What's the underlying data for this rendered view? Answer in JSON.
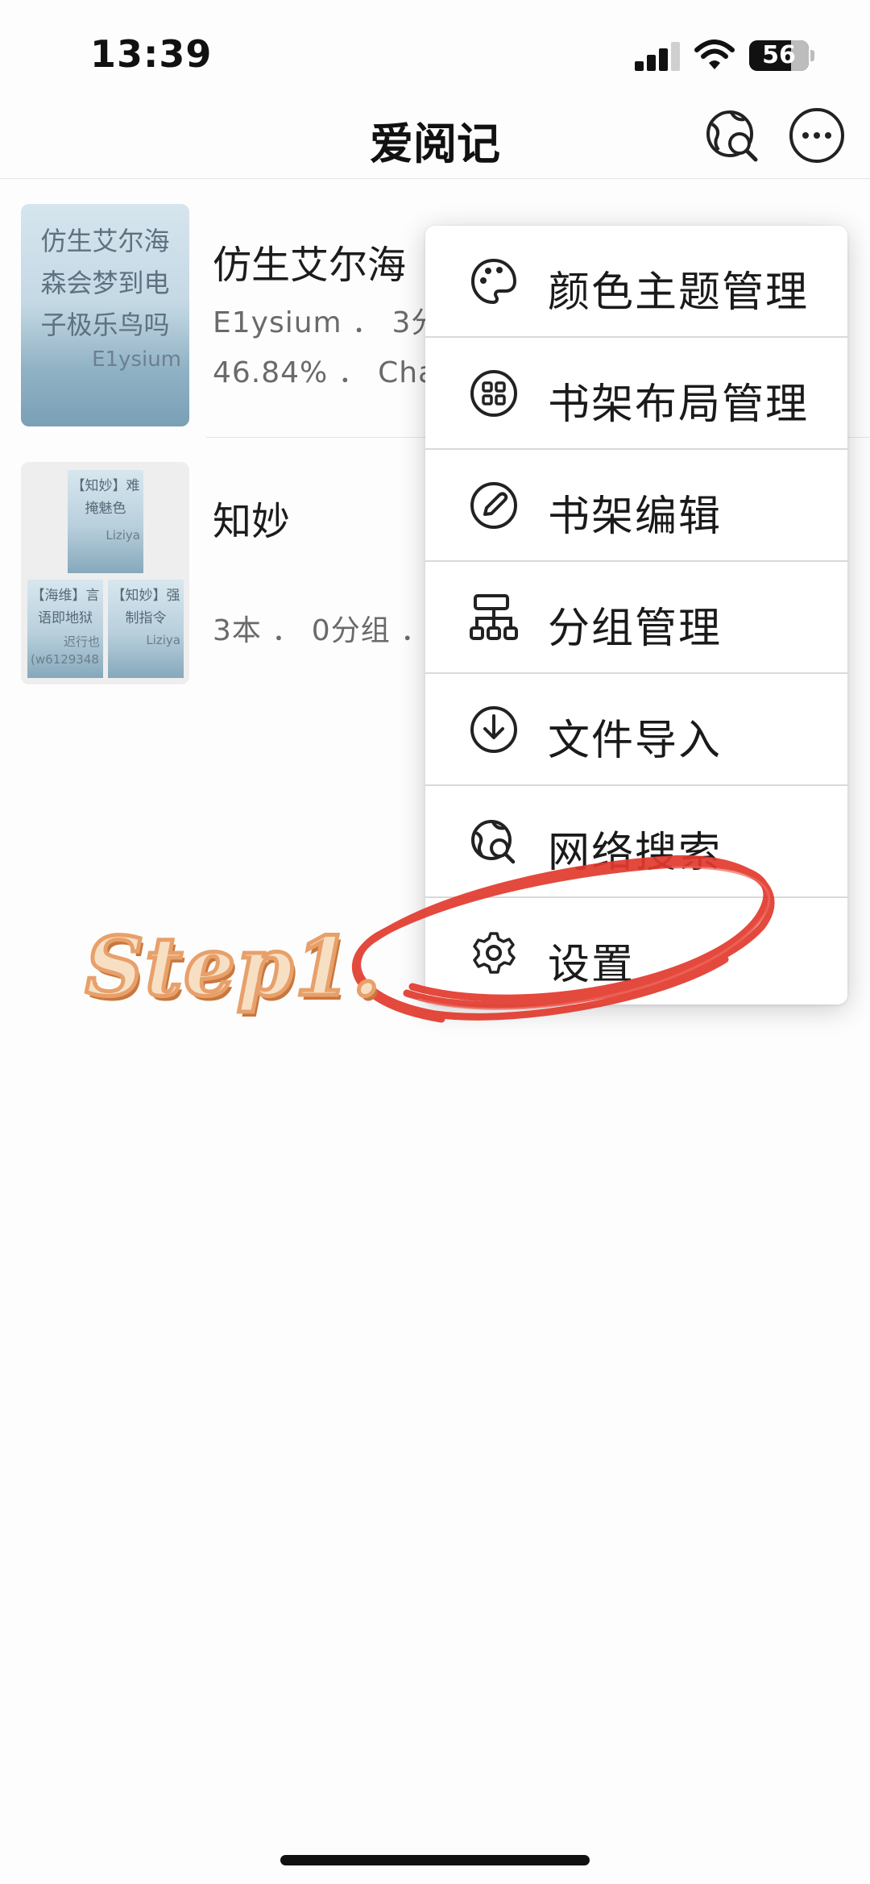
{
  "status_bar": {
    "time": "13:39",
    "battery": "56"
  },
  "nav": {
    "title": "爱阅记",
    "search_icon": "globe-search-icon",
    "more_icon": "more-circle-icon"
  },
  "books": [
    {
      "cover_title": "仿生艾尔海森会梦到电子极乐鸟吗",
      "cover_lines": [
        "仿生艾尔海",
        "森会梦到电",
        "子极乐鸟吗"
      ],
      "cover_author": "E1ysium",
      "title": "仿生艾尔海",
      "meta1": "E1ysium ． 3分",
      "meta2": "46.84% ． Cha"
    },
    {
      "title": "知妙",
      "meta": "3本 ． 0分组 ．",
      "mini_covers": [
        {
          "lines": [
            "【知妙】难",
            "掩魅色"
          ],
          "author": "Liziya"
        },
        {
          "lines": [
            "【海维】言",
            "语即地狱"
          ],
          "author": "迟行也",
          "extra": "(w6129348"
        },
        {
          "lines": [
            "【知妙】强",
            "制指令"
          ],
          "author": "Liziya"
        }
      ]
    }
  ],
  "menu": {
    "items": [
      {
        "label": "颜色主题管理",
        "icon": "palette-icon"
      },
      {
        "label": "书架布局管理",
        "icon": "grid-layout-icon"
      },
      {
        "label": "书架编辑",
        "icon": "edit-pen-icon"
      },
      {
        "label": "分组管理",
        "icon": "group-hierarchy-icon"
      },
      {
        "label": "文件导入",
        "icon": "download-circle-icon"
      },
      {
        "label": "网络搜索",
        "icon": "globe-search-icon"
      },
      {
        "label": "设置",
        "icon": "gear-icon"
      }
    ]
  },
  "annotation": {
    "step_text": "Step1.",
    "highlight_color": "#e23a2e"
  }
}
